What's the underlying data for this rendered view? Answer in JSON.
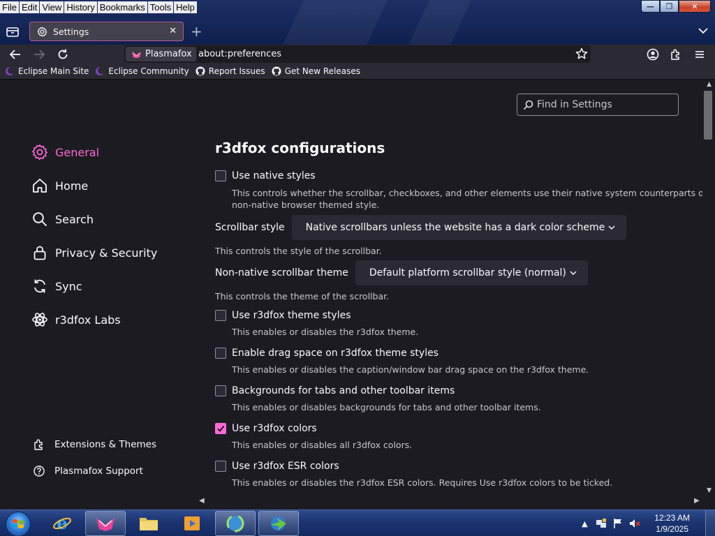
{
  "menubar": [
    "File",
    "Edit",
    "View",
    "History",
    "Bookmarks",
    "Tools",
    "Help"
  ],
  "window_controls": {
    "minimize": "—",
    "maximize": "❐",
    "close": "✕"
  },
  "tab": {
    "title": "Settings",
    "close": "✕",
    "new_tab": "+"
  },
  "urlbar": {
    "identity": "Plasmafox",
    "url": "about:preferences"
  },
  "bookmarks": [
    {
      "label": "Eclipse Main Site",
      "icon": "eclipse-icon"
    },
    {
      "label": "Eclipse Community",
      "icon": "eclipse-icon"
    },
    {
      "label": "Report Issues",
      "icon": "github-icon"
    },
    {
      "label": "Get New Releases",
      "icon": "github-icon"
    }
  ],
  "search": {
    "placeholder": "Find in Settings"
  },
  "categories": [
    {
      "label": "General",
      "icon": "gear-icon"
    },
    {
      "label": "Home",
      "icon": "home-icon"
    },
    {
      "label": "Search",
      "icon": "search-icon"
    },
    {
      "label": "Privacy & Security",
      "icon": "lock-icon"
    },
    {
      "label": "Sync",
      "icon": "sync-icon"
    },
    {
      "label": "r3dfox Labs",
      "icon": "labs-icon"
    }
  ],
  "footer": [
    {
      "label": "Extensions & Themes",
      "icon": "puzzle-icon"
    },
    {
      "label": "Plasmafox Support",
      "icon": "help-icon"
    }
  ],
  "main": {
    "title": "r3dfox configurations",
    "native_styles": {
      "label": "Use native styles",
      "checked": false,
      "desc1": "This controls whether the scrollbar, checkboxes, and other elements use their native system counterparts or the",
      "desc2": "non-native browser themed style."
    },
    "scrollbar_style": {
      "label": "Scrollbar style",
      "value": "Native scrollbars unless the website has a dark color scheme",
      "desc": "This controls the style of the scrollbar."
    },
    "scrollbar_theme": {
      "label": "Non-native scrollbar theme",
      "value": "Default platform scrollbar style (normal)",
      "desc": "This controls the theme of the scrollbar."
    },
    "options": [
      {
        "label": "Use r3dfox theme styles",
        "desc": "This enables or disables the r3dfox theme.",
        "checked": false
      },
      {
        "label": "Enable drag space on r3dfox theme styles",
        "desc": "This enables or disables the caption/window bar drag space on the r3dfox theme.",
        "checked": false
      },
      {
        "label": "Backgrounds for tabs and other toolbar items",
        "desc": "This enables or disables backgrounds for tabs and other toolbar items.",
        "checked": false
      },
      {
        "label": "Use r3dfox colors",
        "desc": "This enables or disables all r3dfox colors.",
        "checked": true
      },
      {
        "label": "Use r3dfox ESR colors",
        "desc": "This enables or disables the r3dfox ESR colors. Requires Use r3dfox colors to be ticked.",
        "checked": false
      }
    ]
  },
  "taskbar": {
    "time": "12:23 AM",
    "date": "1/9/2025"
  },
  "colors": {
    "accent": "#ff6bd7",
    "bg": "#1c1b22",
    "toolbar": "#2b2a33"
  }
}
